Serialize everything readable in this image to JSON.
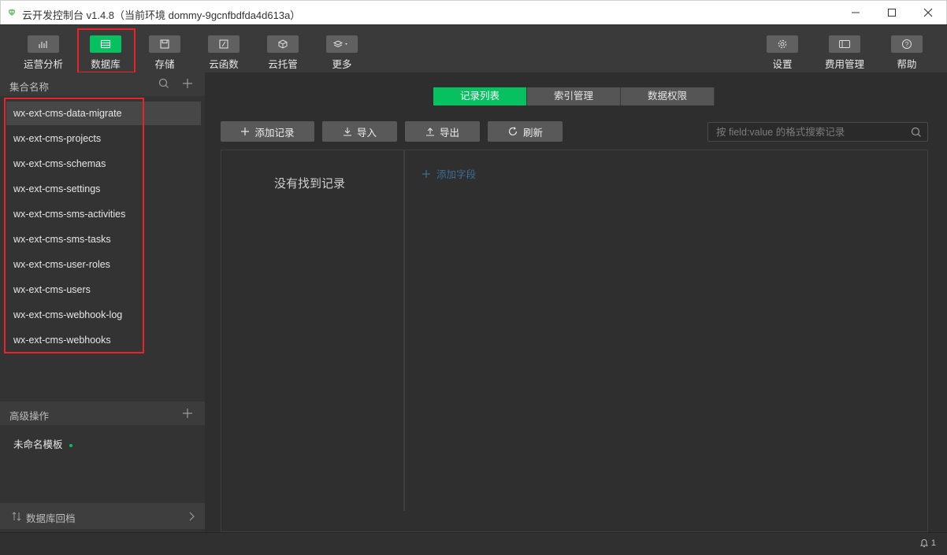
{
  "window": {
    "title": "云开发控制台 v1.4.8（当前环境 dommy-9gcnfbdfda4d613a）"
  },
  "toolbar": {
    "items": [
      {
        "label": "运营分析",
        "icon": "bar-chart-icon"
      },
      {
        "label": "数据库",
        "icon": "database-icon",
        "active": true
      },
      {
        "label": "存储",
        "icon": "save-icon"
      },
      {
        "label": "云函数",
        "icon": "function-icon"
      },
      {
        "label": "云托管",
        "icon": "cube-icon"
      },
      {
        "label": "更多",
        "icon": "layers-icon"
      },
      {
        "label": "设置",
        "icon": "gear-icon"
      },
      {
        "label": "费用管理",
        "icon": "wallet-icon"
      },
      {
        "label": "帮助",
        "icon": "help-icon"
      }
    ]
  },
  "sidebar": {
    "header": "集合名称",
    "collections": [
      "wx-ext-cms-data-migrate",
      "wx-ext-cms-projects",
      "wx-ext-cms-schemas",
      "wx-ext-cms-settings",
      "wx-ext-cms-sms-activities",
      "wx-ext-cms-sms-tasks",
      "wx-ext-cms-user-roles",
      "wx-ext-cms-users",
      "wx-ext-cms-webhook-log",
      "wx-ext-cms-webhooks"
    ],
    "selected_index": 0,
    "advanced_header": "高级操作",
    "template_item": "未命名模板",
    "rollback_label": "数据库回档"
  },
  "main": {
    "tabs": [
      "记录列表",
      "索引管理",
      "数据权限"
    ],
    "active_tab": 0,
    "buttons": {
      "add": "添加记录",
      "import": "导入",
      "export": "导出",
      "refresh": "刷新"
    },
    "search_placeholder": "按 field:value 的格式搜索记录",
    "empty_text": "没有找到记录",
    "add_field": "添加字段"
  },
  "statusbar": {
    "notification_count": "1"
  },
  "colors": {
    "accent": "#07c160",
    "highlight_box": "#e8242a",
    "link": "#3b6d93"
  }
}
